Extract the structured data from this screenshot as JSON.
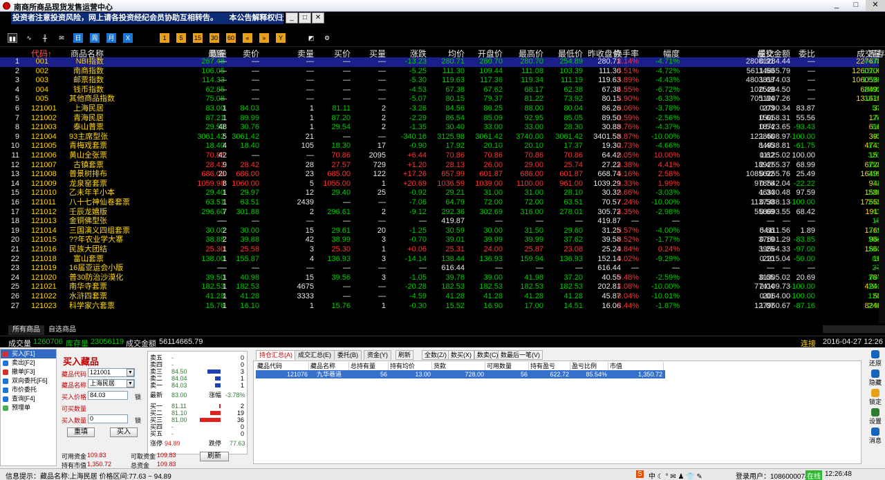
{
  "app": {
    "title": "南商所商品现货发售运营中心",
    "ticker": "投资者注意投资风险，网上请各投资经纪会员协助互相转告。　　本公告解释权归运营中心所有，未尽事宜",
    "window_buttons": [
      "_",
      "□",
      "✕"
    ],
    "ticker_buttons": [
      "_",
      "□",
      "✕"
    ]
  },
  "toolbar": {
    "icons": [
      {
        "name": "bar-chart-icon",
        "glyph": "▮▮",
        "style": "sel"
      },
      {
        "name": "line-chart-icon",
        "glyph": "∿",
        "style": ""
      },
      {
        "name": "candle-icon",
        "glyph": "╫",
        "style": ""
      },
      {
        "name": "mail-icon",
        "glyph": "✉",
        "style": ""
      },
      {
        "name": "day-icon",
        "glyph": "日",
        "style": "blue"
      },
      {
        "name": "week-icon",
        "glyph": "周",
        "style": "blue"
      },
      {
        "name": "month-icon",
        "glyph": "月",
        "style": "blue"
      },
      {
        "name": "x-icon",
        "glyph": "X",
        "style": "blue"
      },
      {
        "name": "num1-icon",
        "glyph": "1",
        "style": "orange"
      },
      {
        "name": "num5-icon",
        "glyph": "5",
        "style": "orange"
      },
      {
        "name": "num15-icon",
        "glyph": "15",
        "style": "orange"
      },
      {
        "name": "num30-icon",
        "glyph": "30",
        "style": "orange"
      },
      {
        "name": "num60-icon",
        "glyph": "60",
        "style": "orange"
      },
      {
        "name": "back-icon",
        "glyph": "«",
        "style": "orange"
      },
      {
        "name": "forward-icon",
        "glyph": "»",
        "style": "orange"
      },
      {
        "name": "year-icon",
        "glyph": "Y",
        "style": "orange"
      },
      {
        "name": "chart-icon",
        "glyph": "◩",
        "style": ""
      },
      {
        "name": "settings-icon",
        "glyph": "⚙",
        "style": ""
      }
    ]
  },
  "columns": [
    "代码↑",
    "商品名称",
    "最新",
    "现量",
    "卖价",
    "卖量",
    "买价",
    "买量",
    "涨跌",
    "均价",
    "开盘价",
    "最高价",
    "最低价",
    "昨收盘价",
    "换手率",
    "幅度",
    "成交金额",
    "量比",
    "委比",
    "成交量",
    "库存量"
  ],
  "rows": [
    [
      "1",
      "001",
      "NBI指数",
      "267.48",
      "—",
      "—",
      "—",
      "—",
      "—",
      "-13.23",
      "280.71",
      "280.70",
      "280.70",
      "254.89",
      "280.71",
      "8.14%",
      "-4.71%",
      "28081284.44",
      "0.91",
      "—",
      "227670",
      "4433350"
    ],
    [
      "2",
      "002",
      "南商指数",
      "106.05",
      "—",
      "—",
      "—",
      "—",
      "—",
      "-5.25",
      "111.30",
      "109.44",
      "111.08",
      "103.39",
      "111.30",
      "5.51%",
      "-4.72%",
      "56114665.79",
      "1.50",
      "—",
      "1260706",
      "22877757"
    ],
    [
      "3",
      "003",
      "邮票指数",
      "114.33",
      "—",
      "—",
      "—",
      "—",
      "—",
      "-5.30",
      "119.63",
      "117.36",
      "119.34",
      "111.19",
      "119.63",
      "5.89%",
      "-4.43%",
      "48038174.03",
      "1.68",
      "—",
      "1060598",
      "17997057"
    ],
    [
      "4",
      "004",
      "钱币指数",
      "62.85",
      "—",
      "—",
      "—",
      "—",
      "—",
      "-4.53",
      "67.38",
      "67.62",
      "68.17",
      "62.38",
      "67.38",
      "4.55%",
      "-6.72%",
      "1025284.50",
      "0.49",
      "—",
      "68492",
      "1505700"
    ],
    [
      "5",
      "005",
      "其他商品指数",
      "75.08",
      "—",
      "—",
      "—",
      "—",
      "—",
      "-5.07",
      "80.15",
      "79.37",
      "81.22",
      "73.92",
      "80.15",
      "3.90%",
      "-6.33%",
      "7051207.26",
      "1.84",
      "—",
      "131616",
      "3375000"
    ],
    [
      "6",
      "121001",
      "上海民居",
      "83.00",
      "1",
      "84.03",
      "1",
      "81.11",
      "2",
      "-3.26",
      "84.56",
      "86.25",
      "88.00",
      "80.04",
      "86.26",
      "0.06%",
      "-3.78%",
      "2790.34",
      "0.03",
      "83.87",
      "33",
      "57780"
    ],
    [
      "7",
      "121002",
      "青海民居",
      "87.21",
      "1",
      "89.99",
      "1",
      "87.20",
      "2",
      "-2.29",
      "86.54",
      "85.09",
      "92.95",
      "85.05",
      "89.50",
      "0.59%",
      "-2.56%",
      "15058.31",
      "0.61",
      "55.56",
      "174",
      "29520"
    ],
    [
      "8",
      "121003",
      "泰山普票",
      "29.53",
      "48",
      "30.76",
      "1",
      "29.54",
      "2",
      "-1.35",
      "30.40",
      "33.00",
      "33.00",
      "28.30",
      "30.88",
      "0.76%",
      "-4.37%",
      "18723.65",
      "0.54",
      "-93.43",
      "616",
      "80900"
    ],
    [
      "9",
      "121004",
      "93主席型张",
      "3061.42",
      "5",
      "3061.42",
      "21",
      "—",
      "—",
      "-340.16",
      "3125.98",
      "3061.42",
      "3740.00",
      "3061.42",
      "3401.58",
      "0.87%",
      "-10.00%",
      "1228508.97",
      "1.46",
      "-100.00",
      "393",
      "45078"
    ],
    [
      "10",
      "121005",
      "青梅戏套票",
      "18.40",
      "4",
      "18.40",
      "105",
      "18.30",
      "17",
      "-0.90",
      "17.92",
      "20.10",
      "20.10",
      "17.37",
      "19.30",
      "2.73%",
      "-4.66%",
      "84938.81",
      "1.45",
      "-61.75",
      "4741",
      "173817"
    ],
    [
      "11",
      "121006",
      "黄山全张票",
      "70.86",
      "42",
      "—",
      "—",
      "70.86",
      "2095",
      "+6.44",
      "70.86",
      "70.86",
      "70.86",
      "70.86",
      "64.42",
      "0.05%",
      "10.00%",
      "11125.02",
      "0.62",
      "100.00",
      "157",
      "320736"
    ],
    [
      "12",
      "121007",
      "古镇套票",
      "28.42",
      "9",
      "28.42",
      "28",
      "27.57",
      "729",
      "+1.20",
      "28.13",
      "26.00",
      "29.00",
      "25.74",
      "27.22",
      "4.38%",
      "4.41%",
      "189255.37",
      "2.47",
      "68.99",
      "6728",
      "153760"
    ],
    [
      "13",
      "121008",
      "普景树排布",
      "686.00",
      "20",
      "686.00",
      "23",
      "685.00",
      "122",
      "+17.26",
      "657.99",
      "601.87",
      "686.00",
      "601.87",
      "668.74",
      "5.16%",
      "2.58%",
      "10856255.76",
      "0.92",
      "25.49",
      "16499",
      "319440"
    ],
    [
      "14",
      "121009",
      "龙泉窑套票",
      "1059.98",
      "8",
      "1060.00",
      "5",
      "1055.00",
      "1",
      "+20.69",
      "1036.59",
      "1039.00",
      "1100.00",
      "961.00",
      "1039.29",
      "1.33%",
      "1.99%",
      "978542.04",
      "0.76",
      "-22.22",
      "944",
      "71012"
    ],
    [
      "15",
      "121010",
      "乙未年羊小本",
      "29.40",
      "1",
      "29.97",
      "12",
      "29.40",
      "25",
      "-0.92",
      "29.21",
      "31.00",
      "31.00",
      "28.10",
      "30.32",
      "0.66%",
      "-3.03%",
      "46330.48",
      "1.34",
      "97.59",
      "1586",
      "239000"
    ],
    [
      "16",
      "121011",
      "八十七神仙卷套票",
      "63.51",
      "1",
      "63.51",
      "2439",
      "—",
      "—",
      "-7.06",
      "64.79",
      "72.00",
      "72.00",
      "63.51",
      "70.57",
      "7.24%",
      "-10.00%",
      "1137388.13",
      "0.50",
      "-100.00",
      "17555",
      "242514"
    ],
    [
      "17",
      "121012",
      "壬辰龙嬉版",
      "296.60",
      "7",
      "301.88",
      "2",
      "296.61",
      "2",
      "-9.12",
      "292.36",
      "302.69",
      "316.00",
      "278.01",
      "305.72",
      "4.35%",
      "-2.98%",
      "558693.55",
      "0.69",
      "68.42",
      "1911",
      "43913"
    ],
    [
      "18",
      "121013",
      "金铜佛型张",
      "—",
      "—",
      "—",
      "—",
      "—",
      "—",
      "—",
      "419.87",
      "—",
      "—",
      "—",
      "419.87",
      "—",
      "—",
      "—",
      "—",
      "—",
      "—",
      "15389"
    ],
    [
      "19",
      "121014",
      "三国演义四组套票",
      "30.00",
      "2",
      "30.00",
      "15",
      "29.61",
      "20",
      "-1.25",
      "30.59",
      "30.00",
      "31.50",
      "29.60",
      "31.25",
      "0.57%",
      "-4.00%",
      "54111.56",
      "0.66",
      "1.89",
      "1769",
      "311684"
    ],
    [
      "20",
      "121015",
      "??年农业学大寨",
      "38.88",
      "2",
      "39.88",
      "42",
      "38.99",
      "3",
      "-0.70",
      "39.01",
      "39.99",
      "39.99",
      "37.62",
      "39.58",
      "0.52%",
      "-1.77%",
      "37601.29",
      "0.19",
      "-83.85",
      "964",
      "186800"
    ],
    [
      "21",
      "121016",
      "民族大团结",
      "25.30",
      "1",
      "25.58",
      "3",
      "25.30",
      "1",
      "+0.06",
      "25.31",
      "24.00",
      "25.87",
      "23.08",
      "25.24",
      "0.84%",
      "0.24%",
      "39564.33",
      "1.25",
      "-97.00",
      "1563",
      "184972"
    ],
    [
      "22",
      "121018",
      "富山套票",
      "138.00",
      "1",
      "155.87",
      "4",
      "136.93",
      "3",
      "-14.14",
      "138.44",
      "136.93",
      "159.94",
      "136.93",
      "152.14",
      "0.02%",
      "-9.29%",
      "2215.04",
      "0.10",
      "-50.00",
      "16",
      "89152"
    ],
    [
      "23",
      "121019",
      "16届亚运会小版",
      "—",
      "—",
      "—",
      "—",
      "—",
      "—",
      "—",
      "616.44",
      "—",
      "—",
      "—",
      "616.44",
      "—",
      "—",
      "—",
      "—",
      "—",
      "—",
      "27806"
    ],
    [
      "24",
      "121020",
      "普30防治沙漠化",
      "39.50",
      "1",
      "40.98",
      "15",
      "39.56",
      "3",
      "-1.05",
      "39.78",
      "39.00",
      "41.98",
      "37.20",
      "40.55",
      "0.48%",
      "-2.59%",
      "31305.02",
      "0.65",
      "20.69",
      "787",
      "164894"
    ],
    [
      "25",
      "121021",
      "南华寺套票",
      "182.53",
      "1",
      "182.53",
      "4675",
      "—",
      "—",
      "-20.28",
      "182.53",
      "182.53",
      "182.53",
      "182.53",
      "202.81",
      "4.08%",
      "-10.00%",
      "774109.73",
      "2.04",
      "-100.00",
      "4241",
      "104000"
    ],
    [
      "26",
      "121022",
      "水浒四套票",
      "41.28",
      "1",
      "41.28",
      "3333",
      "—",
      "—",
      "-4.59",
      "41.28",
      "41.28",
      "41.28",
      "41.28",
      "45.87",
      "0.04%",
      "-10.01%",
      "2064.00",
      "0.01",
      "-100.00",
      "50",
      "123200"
    ],
    [
      "27",
      "121023",
      "科学家六套票",
      "15.76",
      "1",
      "16.10",
      "1",
      "15.76",
      "1",
      "-0.30",
      "15.52",
      "16.90",
      "17.00",
      "14.51",
      "16.06",
      "3.44%",
      "-1.87%",
      "127960.67",
      "1.07",
      "-87.16",
      "8246",
      "240000"
    ]
  ],
  "market_tabs": [
    "所有商品",
    "自选商品"
  ],
  "status": {
    "volume_label": "成交量",
    "volume": "1260706",
    "stock_label": "库存量",
    "stock": "23056119",
    "amount_label": "成交金额",
    "amount": "56114665.79",
    "connection": "连接",
    "datetime": "2016-04-27 12:26"
  },
  "nav": [
    {
      "label": "买入[F1]",
      "color": "#d32f2f"
    },
    {
      "label": "卖出[F2]",
      "color": "#1976d2"
    },
    {
      "label": "撤单[F3]",
      "color": "#d32f2f"
    },
    {
      "label": "双向委托[F6]",
      "color": "#1976d2"
    },
    {
      "label": "市价委托",
      "color": "#1976d2"
    },
    {
      "label": "查询[F4]",
      "color": "#1976d2"
    },
    {
      "label": "预埋单",
      "color": "#4caf50"
    }
  ],
  "order_form": {
    "title": "买入藏品",
    "code_label": "藏品代码",
    "code_value": "121001",
    "name_label": "藏品名称",
    "name_value": "上海民居",
    "price_label": "买入价格",
    "price_value": "84.03",
    "lock1": "锁",
    "max_label": "可买数量",
    "qty_label": "买入数量",
    "qty_value": "0",
    "lock2": "锁",
    "reset_btn": "重填",
    "submit_btn": "买入"
  },
  "order_book": {
    "asks": [
      {
        "label": "卖五",
        "price": "-",
        "vol": "0"
      },
      {
        "label": "卖四",
        "price": "-",
        "vol": "0"
      },
      {
        "label": "卖三",
        "price": "84.50",
        "vol": "3"
      },
      {
        "label": "卖二",
        "price": "84.04",
        "vol": "1"
      },
      {
        "label": "卖一",
        "price": "84.03",
        "vol": "1"
      }
    ],
    "ask_fills": [
      0,
      0,
      0.62,
      0.25,
      0.25
    ],
    "last_label": "最新",
    "last": "83.00",
    "change_label": "涨幅",
    "change": "-3.78%",
    "bids": [
      {
        "label": "买一",
        "price": "81.11",
        "vol": "2"
      },
      {
        "label": "买二",
        "price": "81.10",
        "vol": "19"
      },
      {
        "label": "买三",
        "price": "81.00",
        "vol": "36"
      },
      {
        "label": "买四",
        "price": "-",
        "vol": "0"
      },
      {
        "label": "买五",
        "price": "-",
        "vol": "0"
      }
    ],
    "bid_fills": [
      0.08,
      0.5,
      1,
      0,
      0
    ],
    "limit_up_label": "涨停",
    "limit_up": "94.89",
    "limit_down_label": "跌停",
    "limit_down": "77.63"
  },
  "funds": {
    "available_label": "可用资金",
    "available": "109.83",
    "withdrawable_label": "可取资金",
    "withdrawable": "109.83",
    "holding_label": "持有市值",
    "holding": "1,350.72",
    "total_label": "总资金",
    "total": "109.83",
    "refresh": "刷新"
  },
  "tabs2": {
    "tabs": [
      "持仓汇总(A)",
      "成交汇总(E)",
      "委托(B)",
      "资金(Y)"
    ],
    "buttons": [
      "刷新",
      "全数(Z/)",
      "数买(X)",
      "数卖(C)",
      "数最后一笔(V)"
    ]
  },
  "holdings": {
    "headers": [
      "藏品代码",
      "藏品名称",
      "总持有量",
      "持有均价",
      "货款",
      "可用数量",
      "持有盈亏",
      "盈亏比例",
      "市值"
    ],
    "row": [
      "121076",
      "九华巷道",
      "56",
      "13.00",
      "728.00",
      "56",
      "622.72",
      "85.54%",
      "1,350.72"
    ]
  },
  "rightbar": [
    {
      "label": "还原",
      "color": "#1565c0"
    },
    {
      "label": "隐藏",
      "color": "#1565c0"
    },
    {
      "label": "锁定",
      "color": "#e6a01a"
    },
    {
      "label": "设置",
      "color": "#2e7d32"
    },
    {
      "label": "消息",
      "color": "#1565c0"
    }
  ],
  "bottom": {
    "info": "信息提示：藏品名称:上海民居  价格区间:77.63 ~ 94.89",
    "ime": "中 ☾ ° ✉ ♟ 👕 ✎",
    "user": "登录用户：108600007450",
    "online": "在线",
    "time": "12:26:48"
  },
  "colors": {
    "up": "#ff3333",
    "down": "#00cc00",
    "flat": "#e8e8e8",
    "code": "#ffd700",
    "name": "#ffd700",
    "stock": "#00ccff",
    "amount": "#e8e8e8"
  }
}
